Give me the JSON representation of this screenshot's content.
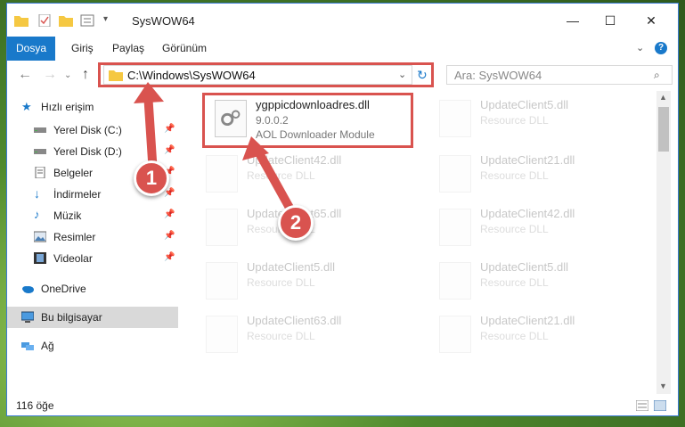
{
  "window": {
    "title": "SysWOW64",
    "minimize": "—",
    "maximize": "☐",
    "close": "✕"
  },
  "ribbon": {
    "tabs": [
      "Dosya",
      "Giriş",
      "Paylaş",
      "Görünüm"
    ]
  },
  "address": {
    "path": "C:\\Windows\\SysWOW64",
    "search_placeholder": "Ara: SysWOW64"
  },
  "nav_pane": {
    "items": [
      {
        "label": "Hızlı erişim",
        "icon": "star-icon"
      },
      {
        "label": "Yerel Disk (C:)",
        "icon": "drive-icon"
      },
      {
        "label": "Yerel Disk (D:)",
        "icon": "drive-icon"
      },
      {
        "label": "Belgeler",
        "icon": "documents-icon"
      },
      {
        "label": "İndirmeler",
        "icon": "download-icon"
      },
      {
        "label": "Müzik",
        "icon": "music-icon"
      },
      {
        "label": "Resimler",
        "icon": "pictures-icon"
      },
      {
        "label": "Videolar",
        "icon": "video-icon"
      },
      {
        "label": "OneDrive",
        "icon": "cloud-icon"
      },
      {
        "label": "Bu bilgisayar",
        "icon": "computer-icon"
      },
      {
        "label": "Ağ",
        "icon": "network-icon"
      }
    ]
  },
  "files": [
    {
      "name": "ygppicdownloadres.dll",
      "version": "9.0.0.2",
      "desc": "AOL Downloader Module"
    },
    {
      "name": "UpdateClient5.dll",
      "desc": "Resource DLL"
    },
    {
      "name": "UpdateClient42.dll",
      "desc": "Resource DLL"
    },
    {
      "name": "UpdateClient21.dll",
      "desc": "Resource DLL"
    },
    {
      "name": "UpdateClient65.dll",
      "desc": "Resource DLL"
    },
    {
      "name": "UpdateClient42.dll",
      "desc": "Resource DLL"
    },
    {
      "name": "UpdateClient5.dll",
      "desc": "Resource DLL"
    },
    {
      "name": "UpdateClient5.dll",
      "desc": "Resource DLL"
    },
    {
      "name": "UpdateClient63.dll",
      "desc": "Resource DLL"
    },
    {
      "name": "UpdateClient21.dll",
      "desc": "Resource DLL"
    }
  ],
  "status": {
    "count": "116 öğe"
  },
  "callouts": [
    "1",
    "2"
  ],
  "colors": {
    "accent": "#1979ca",
    "highlight": "#d9534f"
  }
}
